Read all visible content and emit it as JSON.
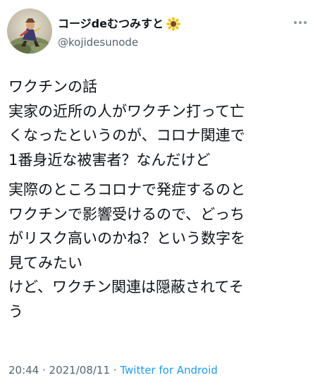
{
  "user": {
    "display_name": "コージdeむつみすと",
    "name_emoji": "sunflower-icon",
    "handle": "@kojidesunode"
  },
  "tweet": {
    "paragraphs": [
      [
        "ワクチンの話",
        "実家の近所の人がワクチン打って亡",
        "くなったというのが、コロナ関連で",
        "1番身近な被害者？なんだけど"
      ],
      [
        "実際のところコロナで発症するのと",
        "ワクチンで影響受けるので、どっち",
        "がリスク高いのかね？という数字を",
        "見てみたい",
        "けど、ワクチン関連は隠蔽されてそ",
        "う"
      ]
    ]
  },
  "meta": {
    "time": "20:44",
    "separator": " · ",
    "date": "2021/08/11",
    "source": "Twitter for Android"
  },
  "colors": {
    "text": "#0f1419",
    "secondary": "#536471",
    "link": "#1d9bf0"
  }
}
